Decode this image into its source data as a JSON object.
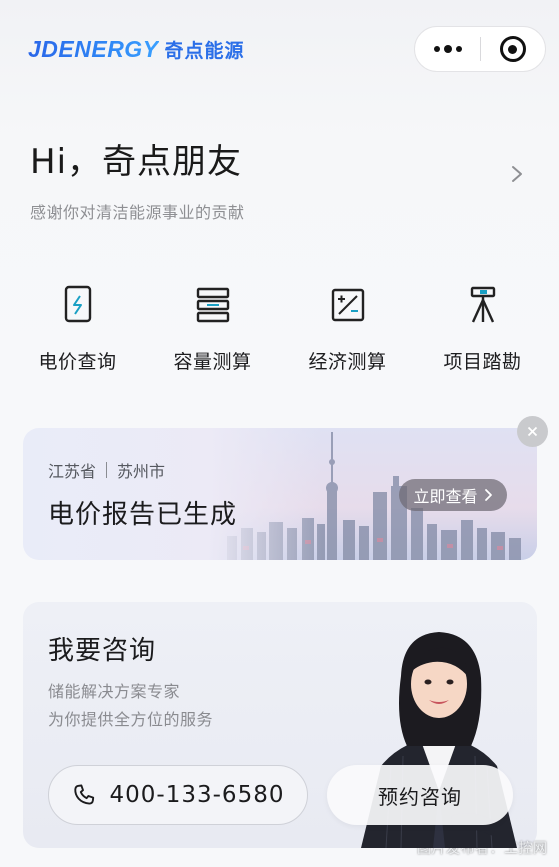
{
  "header": {
    "logo_mark": "JDENERGY",
    "logo_cn": "奇点能源",
    "more_icon": "more-dots-icon",
    "close_icon": "miniprogram-close-icon"
  },
  "greeting": {
    "title": "Hi，奇点朋友",
    "subtitle": "感谢你对清洁能源事业的贡献"
  },
  "tools": [
    {
      "label": "电价查询",
      "icon": "battery-bolt-icon"
    },
    {
      "label": "容量测算",
      "icon": "server-stack-icon"
    },
    {
      "label": "经济测算",
      "icon": "calculator-icon"
    },
    {
      "label": "项目踏勘",
      "icon": "survey-tripod-icon"
    }
  ],
  "report_banner": {
    "province": "江苏省",
    "city": "苏州市",
    "title": "电价报告已生成",
    "view_button": "立即查看",
    "close_icon": "close-icon"
  },
  "consult": {
    "title": "我要咨询",
    "line1": "储能解决方案专家",
    "line2": "为你提供全方位的服务",
    "phone": "400-133-6580",
    "book_button": "预约咨询"
  },
  "watermark": "图片发布者：工控网",
  "colors": {
    "brand_blue": "#2b6fe8",
    "text_primary": "#1b1b1d",
    "text_secondary": "#8e8f93"
  }
}
